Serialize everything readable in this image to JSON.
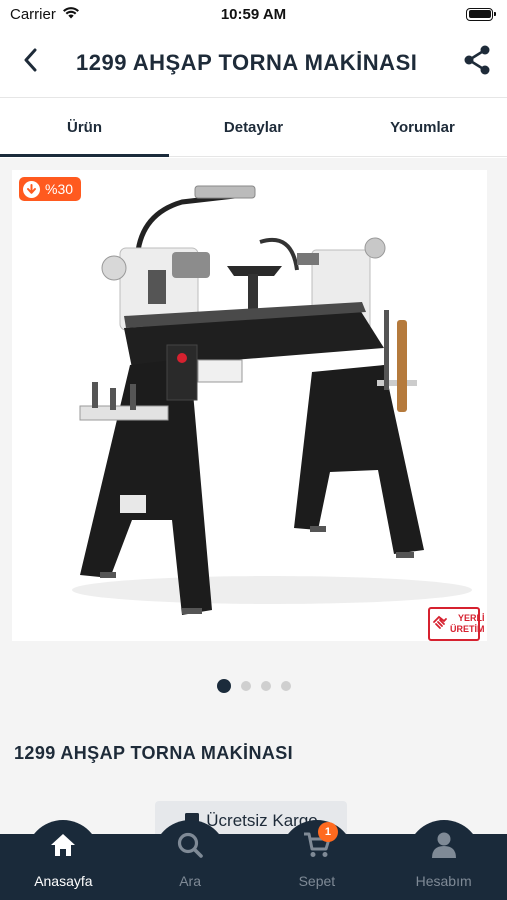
{
  "status_bar": {
    "carrier": "Carrier",
    "time": "10:59 AM",
    "battery_level": 1.0
  },
  "header": {
    "title": "1299 AHŞAP TORNA MAKİNASI",
    "back_icon": "chevron-left-icon",
    "share_icon": "share-icon"
  },
  "tabs": [
    {
      "label": "Ürün",
      "active": true
    },
    {
      "label": "Detaylar",
      "active": false
    },
    {
      "label": "Yorumlar",
      "active": false
    }
  ],
  "product": {
    "discount_badge": "%30",
    "origin_badge": {
      "line1": "YERLİ",
      "line2": "ÜRETİM"
    },
    "name": "1299 AHŞAP TORNA MAKİNASI",
    "image_count": 4,
    "active_image_index": 0,
    "free_shipping_label": "Ücretsiz Kargo"
  },
  "bottom_nav": [
    {
      "label": "Anasayfa",
      "icon": "home-icon",
      "active": true
    },
    {
      "label": "Ara",
      "icon": "search-icon",
      "active": false
    },
    {
      "label": "Sepet",
      "icon": "cart-icon",
      "active": false,
      "badge": "1"
    },
    {
      "label": "Hesabım",
      "icon": "user-icon",
      "active": false
    }
  ],
  "colors": {
    "brand_dark": "#1a2a3a",
    "accent_orange": "#ff5a1f",
    "origin_red": "#d6212f"
  }
}
